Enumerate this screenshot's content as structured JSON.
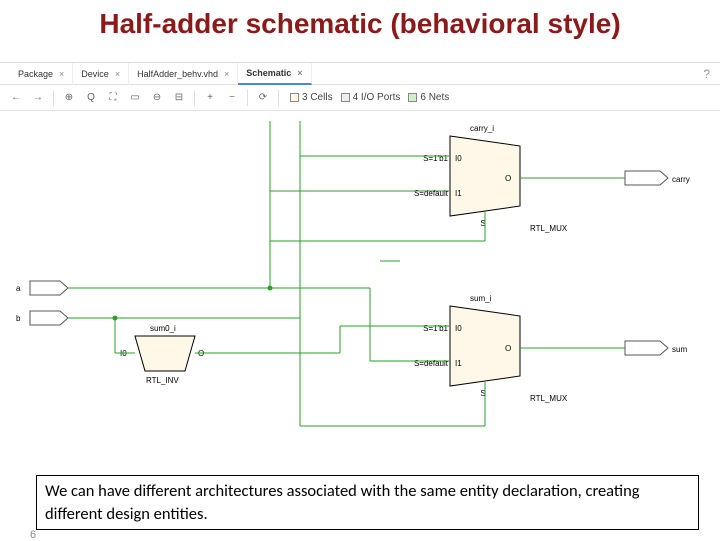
{
  "title": "Half-adder schematic (behavioral style)",
  "tabs": [
    {
      "label": "Package"
    },
    {
      "label": "Device"
    },
    {
      "label": "HalfAdder_behv.vhd"
    },
    {
      "label": "Schematic",
      "active": true
    }
  ],
  "help_icon": "?",
  "close_glyph": "×",
  "toolbar": {
    "stats": {
      "cells": "3 Cells",
      "ports": "4 I/O Ports",
      "nets": "6 Nets"
    }
  },
  "schematic": {
    "inputs": {
      "a_label": "a",
      "b_label": "b"
    },
    "outputs": {
      "carry_label": "carry",
      "sum_label": "sum"
    },
    "inv": {
      "name": "RTL_INV",
      "instance": "sum0_i",
      "pin_in": "I0",
      "pin_out": "O"
    },
    "mux_top": {
      "name": "RTL_MUX",
      "net": "carry_i",
      "sel_val": "S=1'b1",
      "def_val": "S=default",
      "pin_i0": "I0",
      "pin_i1": "I1",
      "pin_s": "S",
      "pin_o": "O"
    },
    "mux_bot": {
      "name": "RTL_MUX",
      "net": "sum_i",
      "sel_val": "S=1'b1",
      "def_val": "S=default",
      "pin_i0": "I0",
      "pin_i1": "I1",
      "pin_s": "S",
      "pin_o": "O"
    }
  },
  "caption": "We can have different architectures associated with the same entity declaration, creating different design entities.",
  "page_number": "6"
}
